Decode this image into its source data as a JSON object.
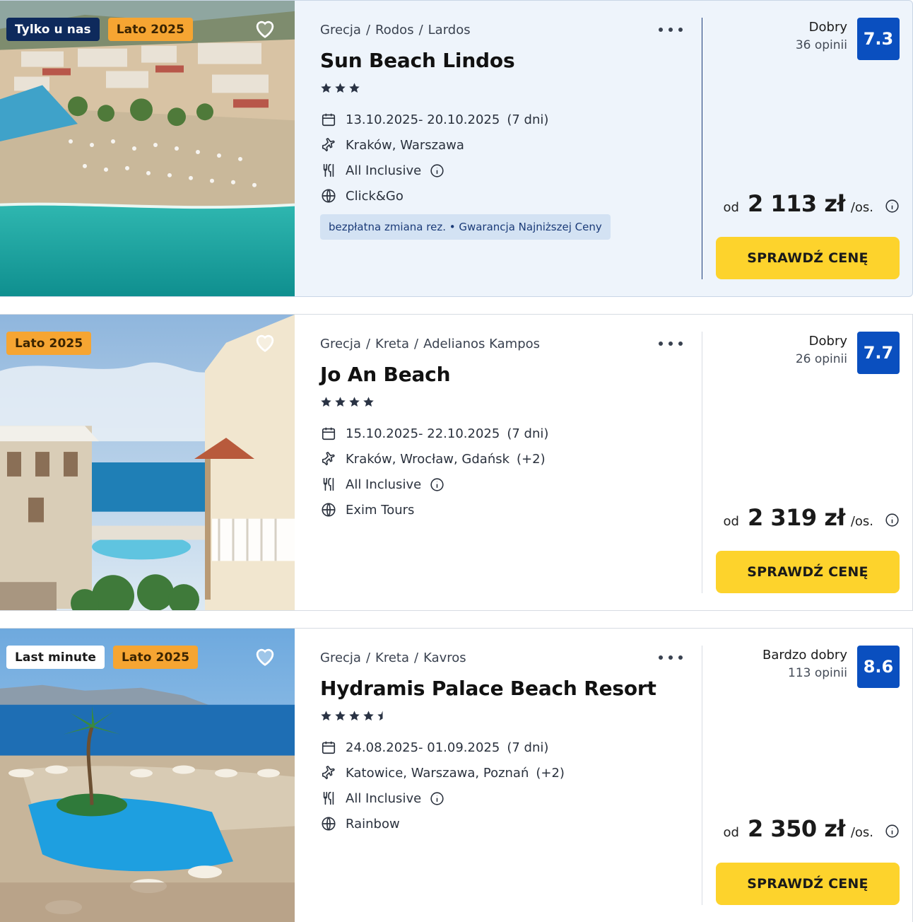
{
  "offers": [
    {
      "badges": [
        "Tylko u nas",
        "Lato 2025"
      ],
      "breadcrumb": [
        "Grecja",
        "Rodos",
        "Lardos"
      ],
      "name": "Sun Beach Lindos",
      "stars": 3,
      "dates": "13.10.2025- 20.10.2025",
      "duration": "(7 dni)",
      "departure": "Kraków, Warszawa",
      "departure_extra": "",
      "board": "All Inclusive",
      "operator": "Click&Go",
      "tags": "bezpłatna zmiana rez. • Gwarancja Najniższej Ceny",
      "rating_label": "Dobry",
      "rating_count": "36 opinii",
      "score": "7.3",
      "price_from": "od",
      "price": "2 113 zł",
      "price_per": "/os.",
      "cta": "SPRAWDŹ CENĘ"
    },
    {
      "badges": [
        "Lato 2025"
      ],
      "breadcrumb": [
        "Grecja",
        "Kreta",
        "Adelianos Kampos"
      ],
      "name": "Jo An Beach",
      "stars": 4,
      "dates": "15.10.2025- 22.10.2025",
      "duration": "(7 dni)",
      "departure": "Kraków, Wrocław, Gdańsk",
      "departure_extra": "(+2)",
      "board": "All Inclusive",
      "operator": "Exim Tours",
      "tags": "",
      "rating_label": "Dobry",
      "rating_count": "26 opinii",
      "score": "7.7",
      "price_from": "od",
      "price": "2 319 zł",
      "price_per": "/os.",
      "cta": "SPRAWDŹ CENĘ"
    },
    {
      "badges": [
        "Last minute",
        "Lato 2025"
      ],
      "breadcrumb": [
        "Grecja",
        "Kreta",
        "Kavros"
      ],
      "name": "Hydramis Palace Beach Resort",
      "stars": 4.5,
      "dates": "24.08.2025- 01.09.2025",
      "duration": "(7 dni)",
      "departure": "Katowice, Warszawa, Poznań",
      "departure_extra": "(+2)",
      "board": "All Inclusive",
      "operator": "Rainbow",
      "tags": "",
      "rating_label": "Bardzo dobry",
      "rating_count": "113 opinii",
      "score": "8.6",
      "price_from": "od",
      "price": "2 350 zł",
      "price_per": "/os.",
      "cta": "SPRAWDŹ CENĘ"
    }
  ],
  "colors": {
    "badge_navy": "#0e2a5c",
    "badge_orange": "#f6a532",
    "score_blue": "#0a4fbf",
    "cta_yellow": "#fdd32c",
    "tag_bg": "#d3e2f3",
    "highlight_bg": "#eef4fb"
  },
  "icons": {
    "favorite": "heart-icon",
    "more": "more-dots-icon",
    "dates": "calendar-icon",
    "departure": "plane-icon",
    "board": "cutlery-icon",
    "operator": "globe-icon",
    "info": "info-icon",
    "stars": "star-icon"
  }
}
